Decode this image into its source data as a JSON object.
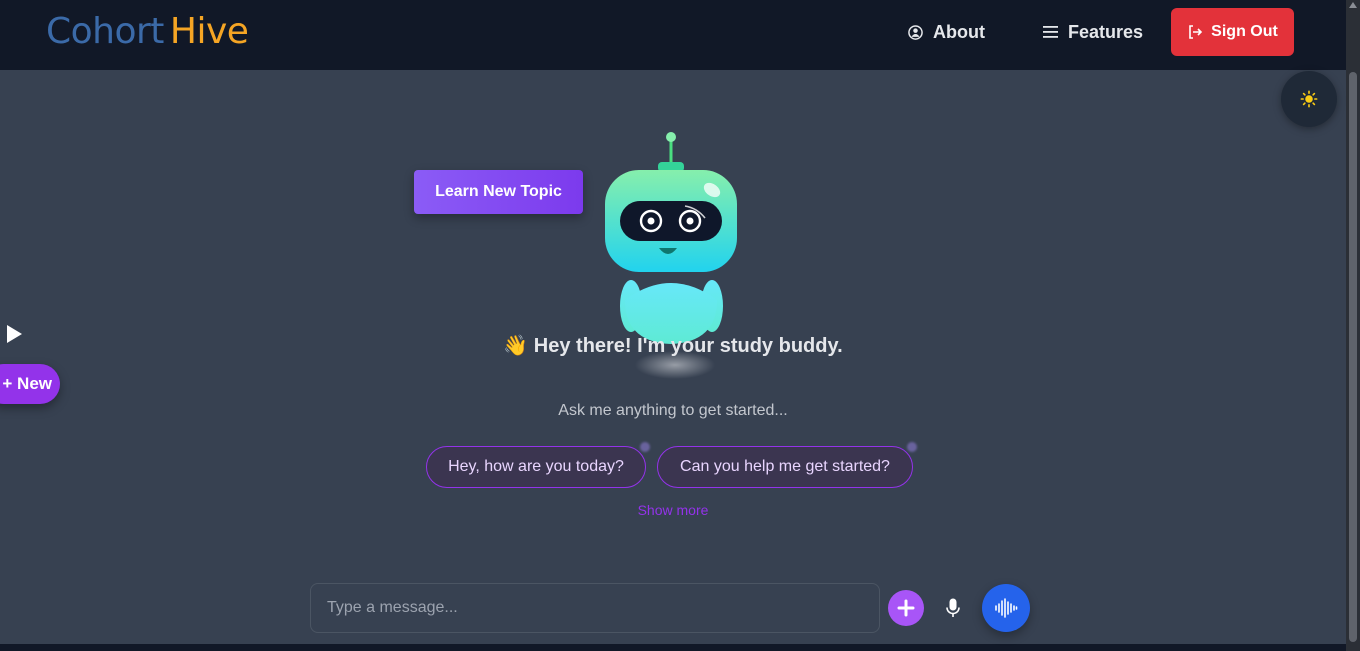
{
  "brand": {
    "part1": "Cohort",
    "part2": "Hive"
  },
  "nav": {
    "about": "About",
    "features": "Features",
    "sign_out": "Sign Out"
  },
  "sidebar": {
    "new_label": "+ New"
  },
  "main": {
    "learn_button": "Learn New Topic",
    "greeting_emoji": "👋",
    "greeting": "Hey there! I'm your study buddy.",
    "subtext": "Ask me anything to get started...",
    "suggestions": [
      "Hey, how are you today?",
      "Can you help me get started?"
    ],
    "show_more": "Show more"
  },
  "composer": {
    "placeholder": "Type a message..."
  },
  "icons": {
    "theme": "sun-icon",
    "about": "user-circle-icon",
    "features": "menu-icon",
    "sign_out": "logout-icon",
    "attach": "plus-icon",
    "mic": "microphone-icon",
    "voice": "waveform-icon",
    "sidebar_toggle": "play-icon"
  },
  "colors": {
    "background": "#374151",
    "navbar": "#111827",
    "brand_primary": "#3b6aa8",
    "brand_accent": "#f5a524",
    "sign_out": "#e3323a",
    "purple_accent": "#9333ea",
    "voice_button": "#2563eb"
  }
}
